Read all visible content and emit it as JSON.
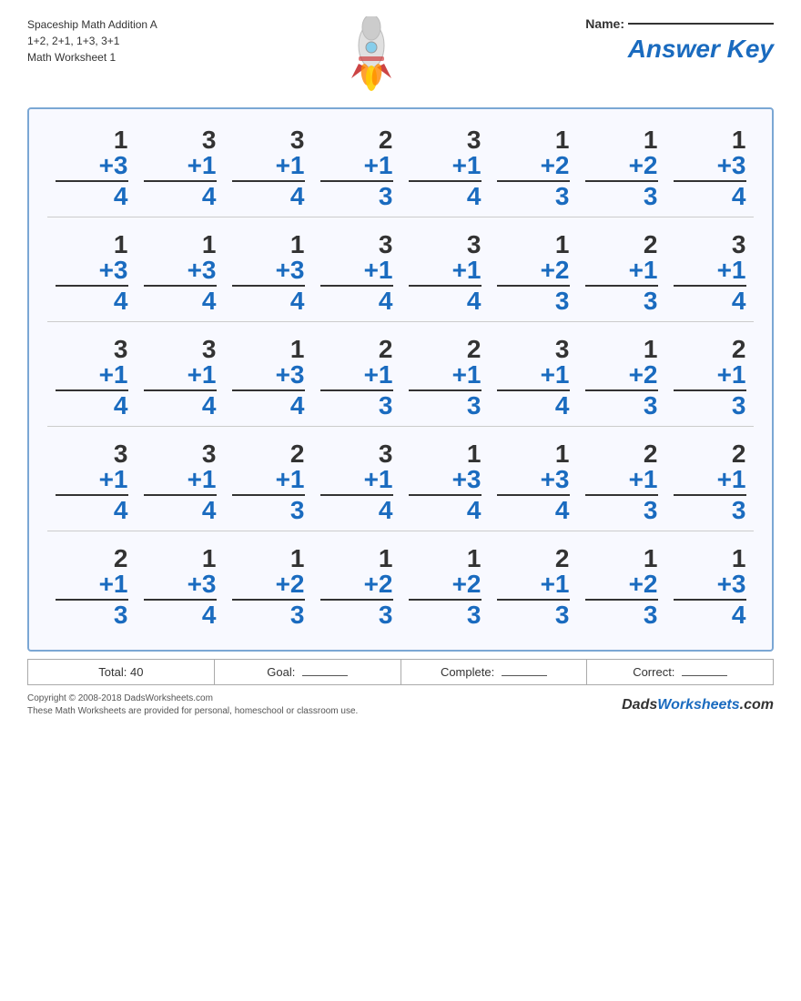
{
  "header": {
    "title_line1": "Spaceship Math Addition A",
    "title_line2": "1+2, 2+1, 1+3, 3+1",
    "title_line3": "Math Worksheet 1",
    "name_label": "Name:",
    "answer_key_label": "Answer Key"
  },
  "rows": [
    [
      {
        "top": "1",
        "add": "+3",
        "ans": "4"
      },
      {
        "top": "3",
        "add": "+1",
        "ans": "4"
      },
      {
        "top": "3",
        "add": "+1",
        "ans": "4"
      },
      {
        "top": "2",
        "add": "+1",
        "ans": "3"
      },
      {
        "top": "3",
        "add": "+1",
        "ans": "4"
      },
      {
        "top": "1",
        "add": "+2",
        "ans": "3"
      },
      {
        "top": "1",
        "add": "+2",
        "ans": "3"
      },
      {
        "top": "1",
        "add": "+3",
        "ans": "4"
      }
    ],
    [
      {
        "top": "1",
        "add": "+3",
        "ans": "4"
      },
      {
        "top": "1",
        "add": "+3",
        "ans": "4"
      },
      {
        "top": "1",
        "add": "+3",
        "ans": "4"
      },
      {
        "top": "3",
        "add": "+1",
        "ans": "4"
      },
      {
        "top": "3",
        "add": "+1",
        "ans": "4"
      },
      {
        "top": "1",
        "add": "+2",
        "ans": "3"
      },
      {
        "top": "2",
        "add": "+1",
        "ans": "3"
      },
      {
        "top": "3",
        "add": "+1",
        "ans": "4"
      }
    ],
    [
      {
        "top": "3",
        "add": "+1",
        "ans": "4"
      },
      {
        "top": "3",
        "add": "+1",
        "ans": "4"
      },
      {
        "top": "1",
        "add": "+3",
        "ans": "4"
      },
      {
        "top": "2",
        "add": "+1",
        "ans": "3"
      },
      {
        "top": "2",
        "add": "+1",
        "ans": "3"
      },
      {
        "top": "3",
        "add": "+1",
        "ans": "4"
      },
      {
        "top": "1",
        "add": "+2",
        "ans": "3"
      },
      {
        "top": "2",
        "add": "+1",
        "ans": "3"
      }
    ],
    [
      {
        "top": "3",
        "add": "+1",
        "ans": "4"
      },
      {
        "top": "3",
        "add": "+1",
        "ans": "4"
      },
      {
        "top": "2",
        "add": "+1",
        "ans": "3"
      },
      {
        "top": "3",
        "add": "+1",
        "ans": "4"
      },
      {
        "top": "1",
        "add": "+3",
        "ans": "4"
      },
      {
        "top": "1",
        "add": "+3",
        "ans": "4"
      },
      {
        "top": "2",
        "add": "+1",
        "ans": "3"
      },
      {
        "top": "2",
        "add": "+1",
        "ans": "3"
      }
    ],
    [
      {
        "top": "2",
        "add": "+1",
        "ans": "3"
      },
      {
        "top": "1",
        "add": "+3",
        "ans": "4"
      },
      {
        "top": "1",
        "add": "+2",
        "ans": "3"
      },
      {
        "top": "1",
        "add": "+2",
        "ans": "3"
      },
      {
        "top": "1",
        "add": "+2",
        "ans": "3"
      },
      {
        "top": "2",
        "add": "+1",
        "ans": "3"
      },
      {
        "top": "1",
        "add": "+2",
        "ans": "3"
      },
      {
        "top": "1",
        "add": "+3",
        "ans": "4"
      }
    ]
  ],
  "footer": {
    "total_label": "Total: 40",
    "goal_label": "Goal:",
    "complete_label": "Complete:",
    "correct_label": "Correct:"
  },
  "copyright": {
    "line1": "Copyright © 2008-2018 DadsWorksheets.com",
    "line2": "These Math Worksheets are provided for personal, homeschool or classroom use.",
    "brand": "DadsWorksheets.com"
  }
}
